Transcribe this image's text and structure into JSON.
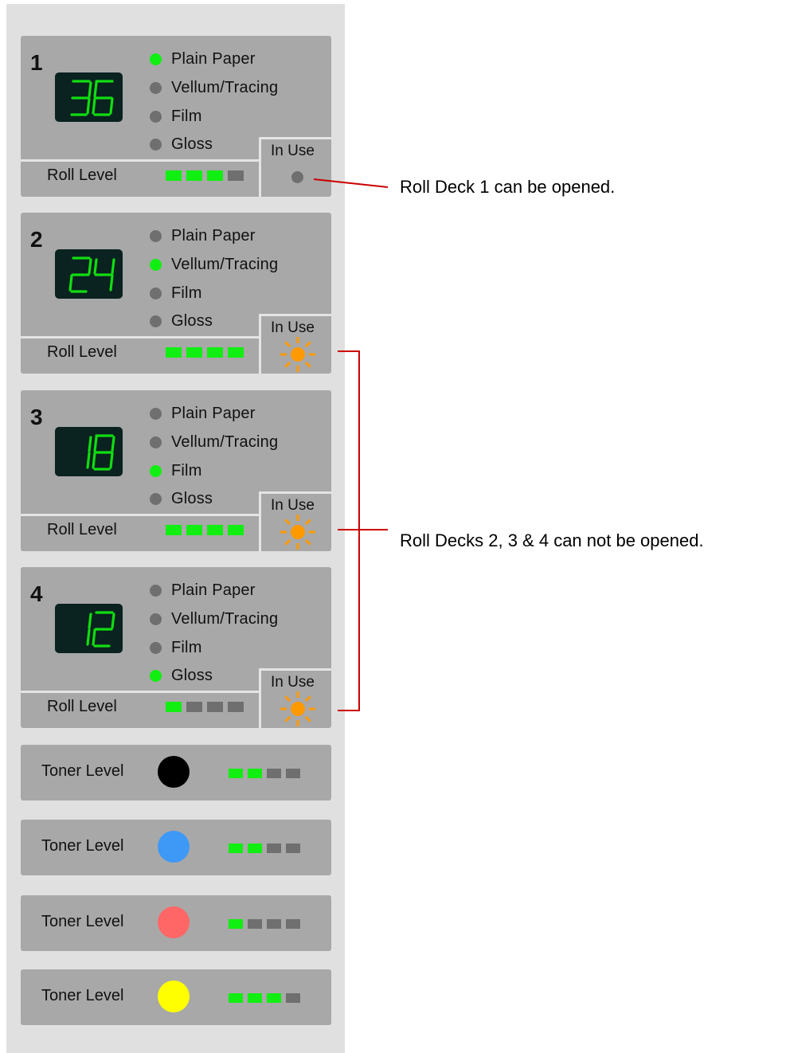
{
  "decks": [
    {
      "number": "1",
      "count": "36",
      "media": [
        "Plain Paper",
        "Vellum/Tracing",
        "Film",
        "Gloss"
      ],
      "active_media": 0,
      "roll_label": "Roll Level",
      "roll_level": 3,
      "roll_max": 4,
      "in_use_label": "In Use",
      "in_use": false
    },
    {
      "number": "2",
      "count": "24",
      "media": [
        "Plain Paper",
        "Vellum/Tracing",
        "Film",
        "Gloss"
      ],
      "active_media": 1,
      "roll_label": "Roll Level",
      "roll_level": 4,
      "roll_max": 4,
      "in_use_label": "In Use",
      "in_use": true
    },
    {
      "number": "3",
      "count": "18",
      "media": [
        "Plain Paper",
        "Vellum/Tracing",
        "Film",
        "Gloss"
      ],
      "active_media": 2,
      "roll_label": "Roll Level",
      "roll_level": 4,
      "roll_max": 4,
      "in_use_label": "In Use",
      "in_use": true
    },
    {
      "number": "4",
      "count": "12",
      "media": [
        "Plain Paper",
        "Vellum/Tracing",
        "Film",
        "Gloss"
      ],
      "active_media": 3,
      "roll_label": "Roll Level",
      "roll_level": 1,
      "roll_max": 4,
      "in_use_label": "In Use",
      "in_use": true
    }
  ],
  "toners": [
    {
      "label": "Toner Level",
      "color": "#000000",
      "level": 2,
      "max": 4
    },
    {
      "label": "Toner Level",
      "color": "#3d99f5",
      "level": 2,
      "max": 4
    },
    {
      "label": "Toner Level",
      "color": "#ff6666",
      "level": 1,
      "max": 4
    },
    {
      "label": "Toner Level",
      "color": "#ffff00",
      "level": 3,
      "max": 4
    }
  ],
  "callouts": {
    "deck1": "Roll Deck 1 can be opened.",
    "decks234": "Roll Decks 2, 3 & 4 can not be opened."
  },
  "colors": {
    "led_on": "#11ee11",
    "led_off": "#6f6f6f",
    "in_use_active": "#ff9900",
    "segment_digit": "#11dd11",
    "callout_line": "#cc0000"
  }
}
